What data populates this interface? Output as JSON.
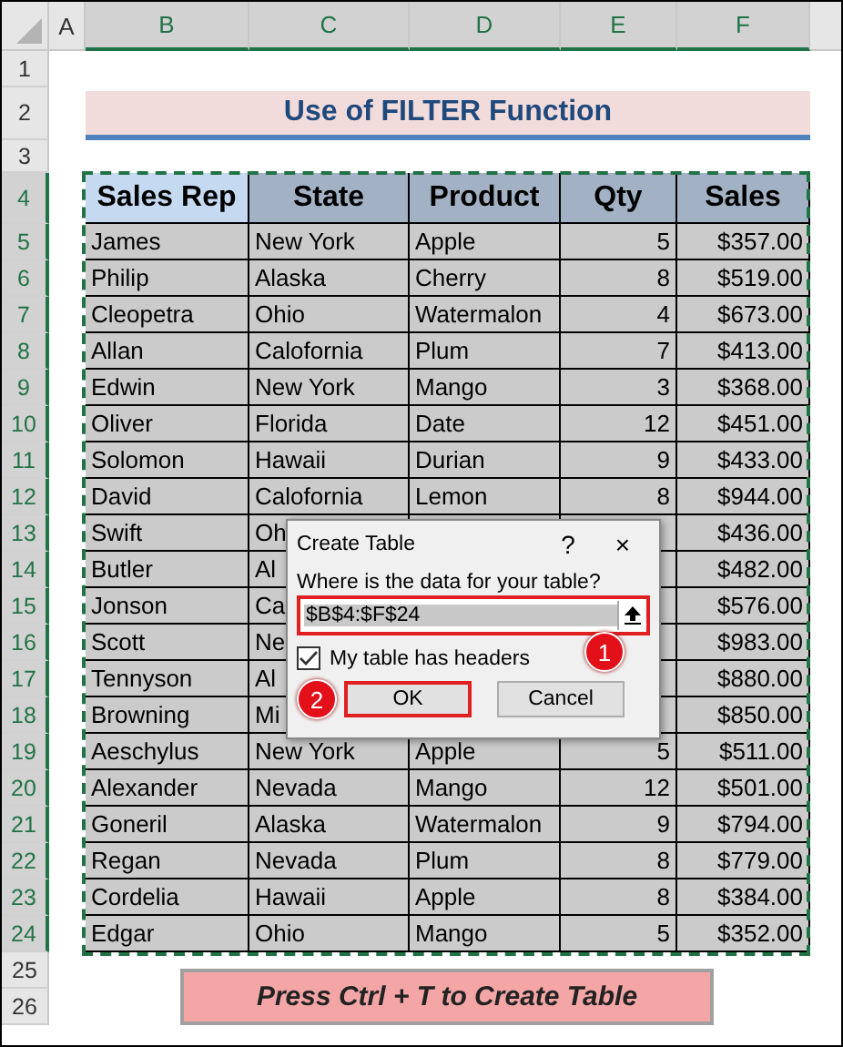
{
  "columns": [
    {
      "letter": "A",
      "selected": false
    },
    {
      "letter": "B",
      "selected": true
    },
    {
      "letter": "C",
      "selected": true
    },
    {
      "letter": "D",
      "selected": true
    },
    {
      "letter": "E",
      "selected": true
    },
    {
      "letter": "F",
      "selected": true
    }
  ],
  "row_numbers": [
    {
      "label": "1",
      "selected": false
    },
    {
      "label": "2",
      "selected": false
    },
    {
      "label": "3",
      "selected": false
    },
    {
      "label": "4",
      "selected": true
    },
    {
      "label": "5",
      "selected": true
    },
    {
      "label": "6",
      "selected": true
    },
    {
      "label": "7",
      "selected": true
    },
    {
      "label": "8",
      "selected": true
    },
    {
      "label": "9",
      "selected": true
    },
    {
      "label": "10",
      "selected": true
    },
    {
      "label": "11",
      "selected": true
    },
    {
      "label": "12",
      "selected": true
    },
    {
      "label": "13",
      "selected": true
    },
    {
      "label": "14",
      "selected": true
    },
    {
      "label": "15",
      "selected": true
    },
    {
      "label": "16",
      "selected": true
    },
    {
      "label": "17",
      "selected": true
    },
    {
      "label": "18",
      "selected": true
    },
    {
      "label": "19",
      "selected": true
    },
    {
      "label": "20",
      "selected": true
    },
    {
      "label": "21",
      "selected": true
    },
    {
      "label": "22",
      "selected": true
    },
    {
      "label": "23",
      "selected": true
    },
    {
      "label": "24",
      "selected": true
    },
    {
      "label": "25",
      "selected": false
    },
    {
      "label": "26",
      "selected": false
    }
  ],
  "title": "Use of FILTER Function",
  "table": {
    "columns": [
      {
        "label": "Sales Rep",
        "selected": true
      },
      {
        "label": "State",
        "selected": false
      },
      {
        "label": "Product",
        "selected": false
      },
      {
        "label": "Qty",
        "selected": false
      },
      {
        "label": "Sales",
        "selected": false
      }
    ],
    "rows": [
      {
        "sales_rep": "James",
        "state": "New York",
        "product": "Apple",
        "qty": "5",
        "sales": "$357.00"
      },
      {
        "sales_rep": "Philip",
        "state": "Alaska",
        "product": "Cherry",
        "qty": "8",
        "sales": "$519.00"
      },
      {
        "sales_rep": "Cleopetra",
        "state": "Ohio",
        "product": "Watermalon",
        "qty": "4",
        "sales": "$673.00"
      },
      {
        "sales_rep": "Allan",
        "state": "Calofornia",
        "product": "Plum",
        "qty": "7",
        "sales": "$413.00"
      },
      {
        "sales_rep": "Edwin",
        "state": "New York",
        "product": "Mango",
        "qty": "3",
        "sales": "$368.00"
      },
      {
        "sales_rep": "Oliver",
        "state": "Florida",
        "product": "Date",
        "qty": "12",
        "sales": "$451.00"
      },
      {
        "sales_rep": "Solomon",
        "state": "Hawaii",
        "product": "Durian",
        "qty": "9",
        "sales": "$433.00"
      },
      {
        "sales_rep": "David",
        "state": "Calofornia",
        "product": "Lemon",
        "qty": "8",
        "sales": "$944.00"
      },
      {
        "sales_rep": "Swift",
        "state": "Oh",
        "sales": "$436.00"
      },
      {
        "sales_rep": "Butler",
        "state": "Al",
        "sales": "$482.00"
      },
      {
        "sales_rep": "Jonson",
        "state": "Ca",
        "sales": "$576.00"
      },
      {
        "sales_rep": "Scott",
        "state": "Ne",
        "sales": "$983.00"
      },
      {
        "sales_rep": "Tennyson",
        "state": "Al",
        "sales": "$880.00"
      },
      {
        "sales_rep": "Browning",
        "state": "Mi",
        "sales": "$850.00"
      },
      {
        "sales_rep": "Aeschylus",
        "state": "New York",
        "product": "Apple",
        "qty": "5",
        "sales": "$511.00"
      },
      {
        "sales_rep": "Alexander",
        "state": "Nevada",
        "product": "Mango",
        "qty": "12",
        "sales": "$501.00"
      },
      {
        "sales_rep": "Goneril",
        "state": "Alaska",
        "product": "Watermalon",
        "qty": "9",
        "sales": "$794.00"
      },
      {
        "sales_rep": "Regan",
        "state": "Nevada",
        "product": "Plum",
        "qty": "8",
        "sales": "$779.00"
      },
      {
        "sales_rep": "Cordelia",
        "state": "Hawaii",
        "product": "Apple",
        "qty": "8",
        "sales": "$384.00"
      },
      {
        "sales_rep": "Edgar",
        "state": "Ohio",
        "product": "Mango",
        "qty": "5",
        "sales": "$352.00"
      }
    ]
  },
  "note": "Press Ctrl + T to Create Table",
  "dialog": {
    "title": "Create Table",
    "help": "?",
    "close": "×",
    "prompt": "Where is the data for your table?",
    "range": "$B$4:$F$24",
    "headers_checkbox": {
      "label": "My table has headers",
      "checked": true
    },
    "buttons": [
      {
        "label": "OK",
        "highlighted": true
      },
      {
        "label": "Cancel",
        "highlighted": false
      }
    ],
    "steps": [
      "1",
      "2"
    ]
  }
}
